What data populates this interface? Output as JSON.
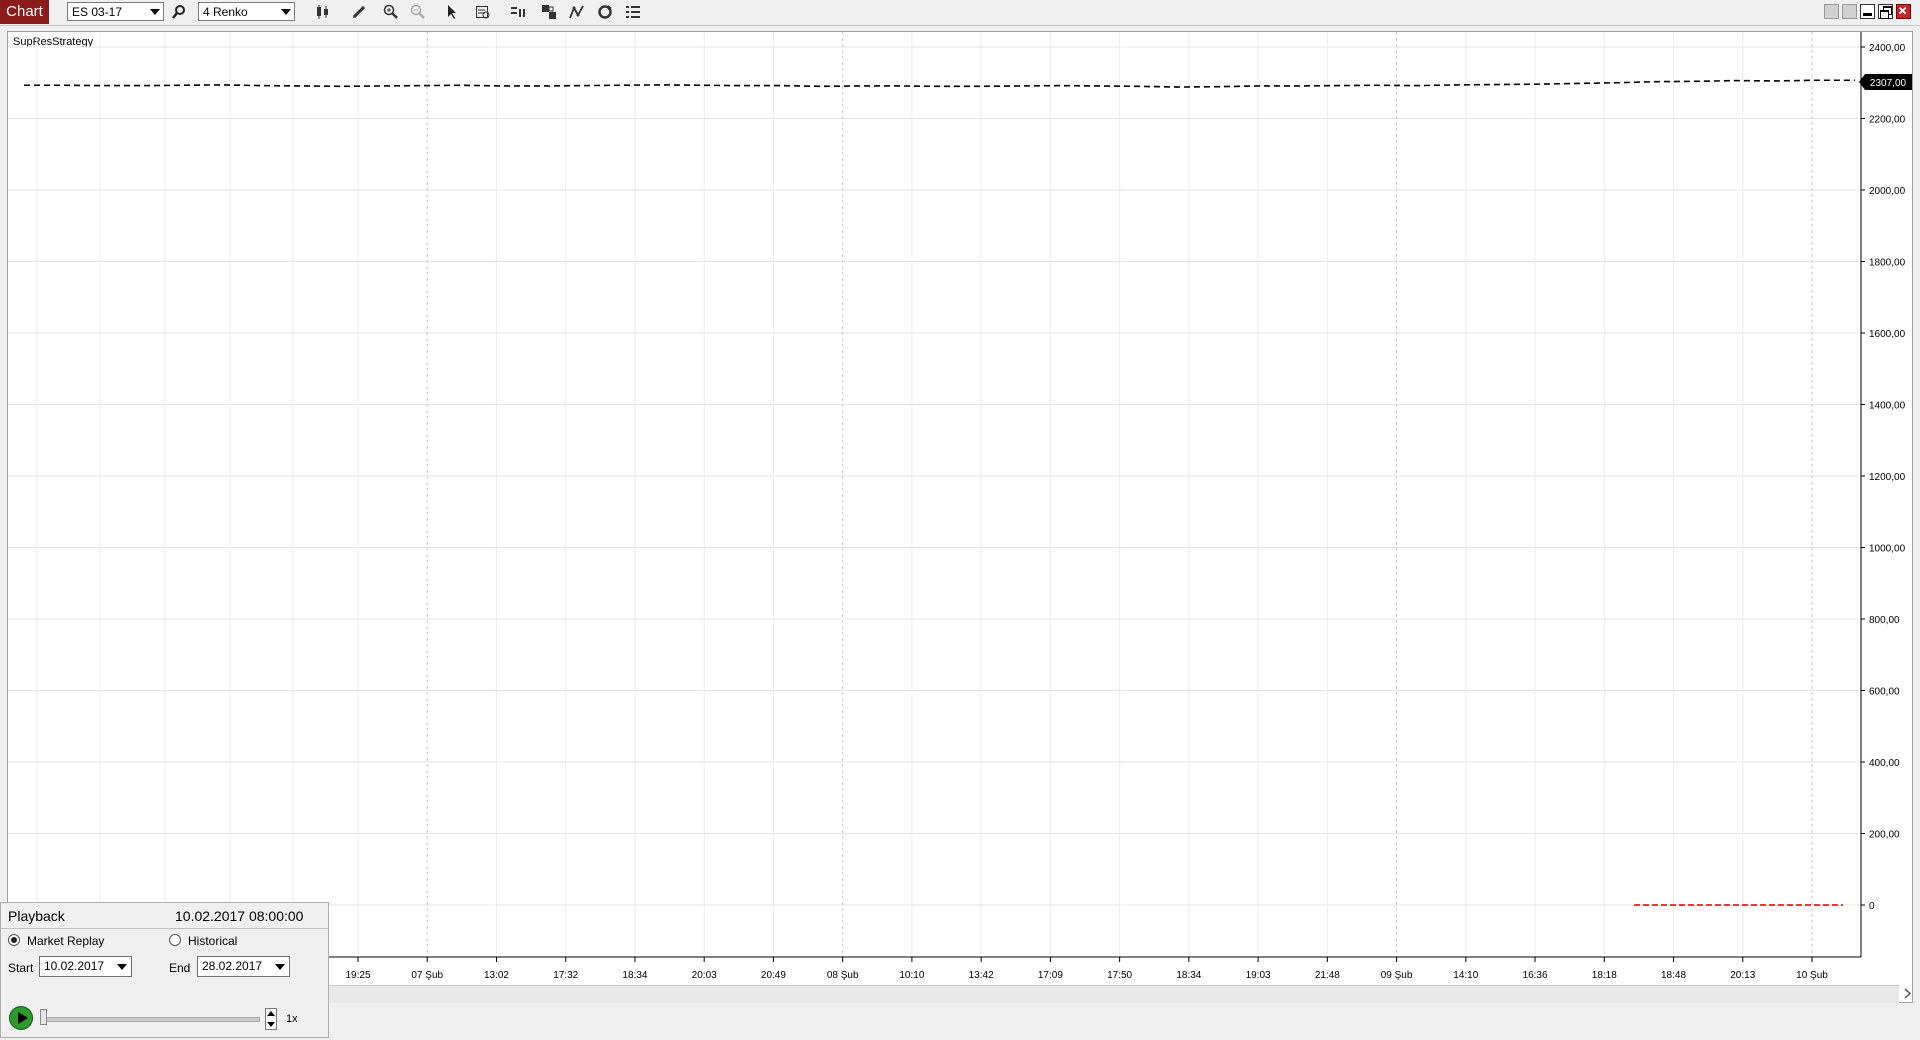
{
  "app": {
    "title": "Chart"
  },
  "toolbar": {
    "instrument": "ES 03-17",
    "bar_type": "4 Renko",
    "icons": [
      "search-icon",
      "bar-style-icon",
      "pencil-icon",
      "zoom-in-icon",
      "zoom-out-icon",
      "pointer-icon",
      "data-box-icon",
      "chart-trader-icon",
      "indicators-icon",
      "strategies-icon",
      "reload-icon",
      "properties-icon"
    ]
  },
  "window_controls": [
    "tile-icon",
    "tile-icon-2",
    "minimize-icon",
    "restore-icon",
    "close-icon"
  ],
  "chart": {
    "strategy_label": "SupResStrategy",
    "price_marker": "2307,00"
  },
  "chart_data": {
    "type": "line",
    "y_ticks": [
      "2400,00",
      "2200,00",
      "2000,00",
      "1800,00",
      "1600,00",
      "1400,00",
      "1200,00",
      "1000,00",
      "800,00",
      "600,00",
      "400,00",
      "200,00",
      "0"
    ],
    "ylim": [
      -150,
      2450
    ],
    "x_ticks": [
      "19:25",
      "07 Şub",
      "13:02",
      "17:32",
      "18:34",
      "20:03",
      "20:49",
      "08 Şub",
      "10:10",
      "13:42",
      "17:09",
      "17:50",
      "18:34",
      "19:03",
      "21:48",
      "09 Şub",
      "14:10",
      "16:36",
      "18:18",
      "18:48",
      "20:13",
      "10 Şub"
    ],
    "series": [
      {
        "color": "#000000",
        "style": "dashed",
        "values": [
          2293,
          2293,
          2292,
          2292,
          2293,
          2294,
          2292,
          2291,
          2290,
          2291,
          2292,
          2293,
          2291,
          2291,
          2292,
          2293,
          2294,
          2293,
          2292,
          2292,
          2290,
          2291,
          2291,
          2290,
          2290,
          2291,
          2292,
          2291,
          2290,
          2288,
          2289,
          2291,
          2291,
          2292,
          2293,
          2292,
          2294,
          2295,
          2296,
          2298,
          2300,
          2303,
          2304,
          2306,
          2305,
          2307,
          2307
        ]
      },
      {
        "color": "#e02020",
        "style": "dashed",
        "values": [
          0,
          0,
          0,
          0,
          0,
          0,
          0,
          0,
          0,
          0,
          0,
          0,
          0,
          0,
          0,
          0,
          0,
          0,
          0,
          0,
          0,
          0,
          0,
          0,
          0,
          0,
          0,
          0,
          0,
          0,
          0,
          0,
          0,
          0,
          0,
          0,
          0,
          0,
          0,
          0,
          0,
          0,
          0,
          0,
          0,
          0,
          0
        ]
      }
    ]
  },
  "playback": {
    "title": "Playback",
    "timestamp": "10.02.2017 08:00:00",
    "market_replay_label": "Market Replay",
    "historical_label": "Historical",
    "start_label": "Start",
    "start_value": "10.02.2017",
    "end_label": "End",
    "end_value": "28.02.2017",
    "speed": "1x"
  }
}
